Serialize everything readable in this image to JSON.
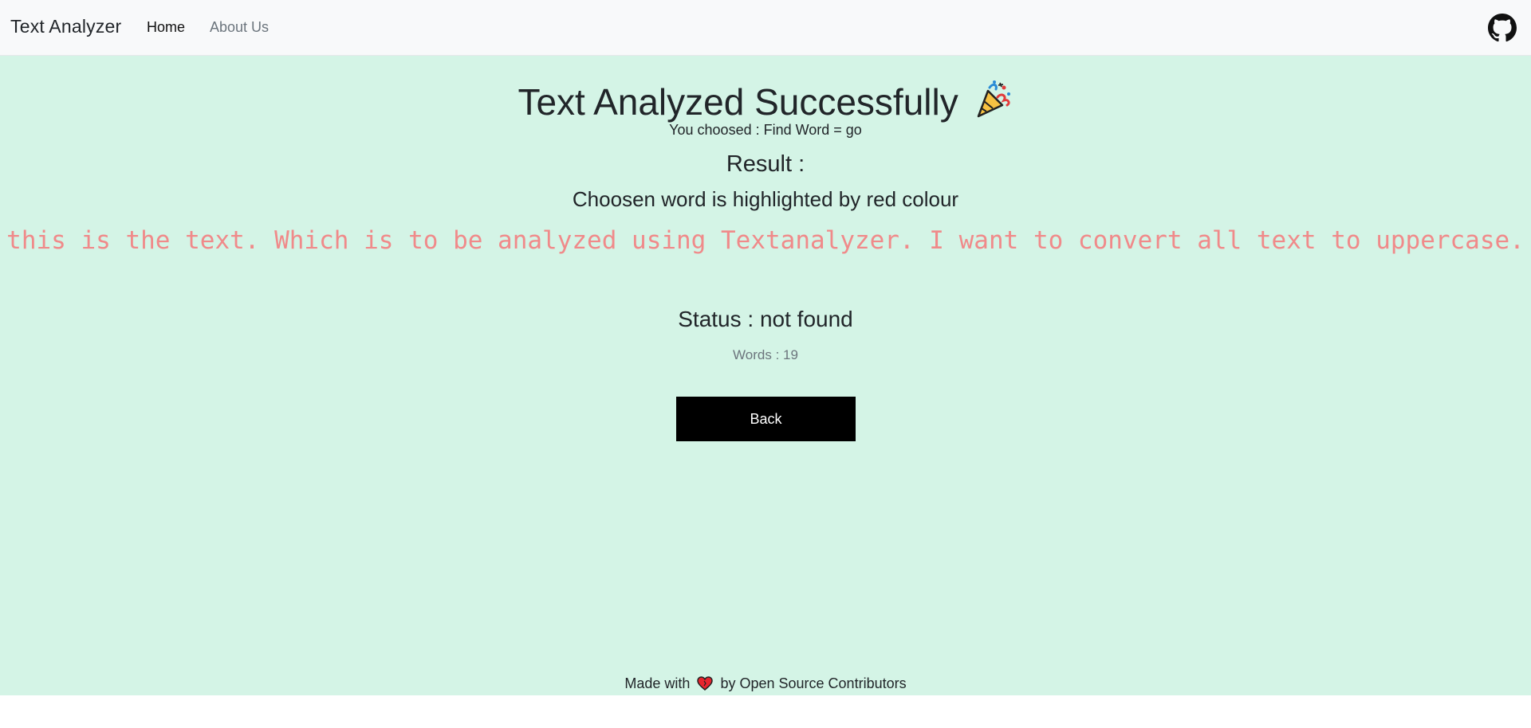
{
  "navbar": {
    "brand": "Text Analyzer",
    "links": [
      "Home",
      "About Us"
    ],
    "github_icon": "github-icon"
  },
  "main": {
    "title": "Text Analyzed Successfully",
    "title_icon": "party-popper-icon",
    "choice": "You choosed : Find Word = go",
    "result_heading": "Result :",
    "highlight_note": "Choosen word is highlighted by red colour",
    "analyzed_text": "this is the text. Which is to be analyzed using Textanalyzer. I want to convert all text to uppercase.",
    "status": "Status : not found",
    "words": "Words : 19",
    "back_label": "Back"
  },
  "footer": {
    "prefix": "Made with",
    "heart_icon": "heart-icon",
    "suffix": "by Open Source Contributors"
  },
  "colors": {
    "background": "#d4f4e6",
    "navbar": "#f8f9fa",
    "highlight_text": "#f08a8a",
    "button": "#000000"
  }
}
